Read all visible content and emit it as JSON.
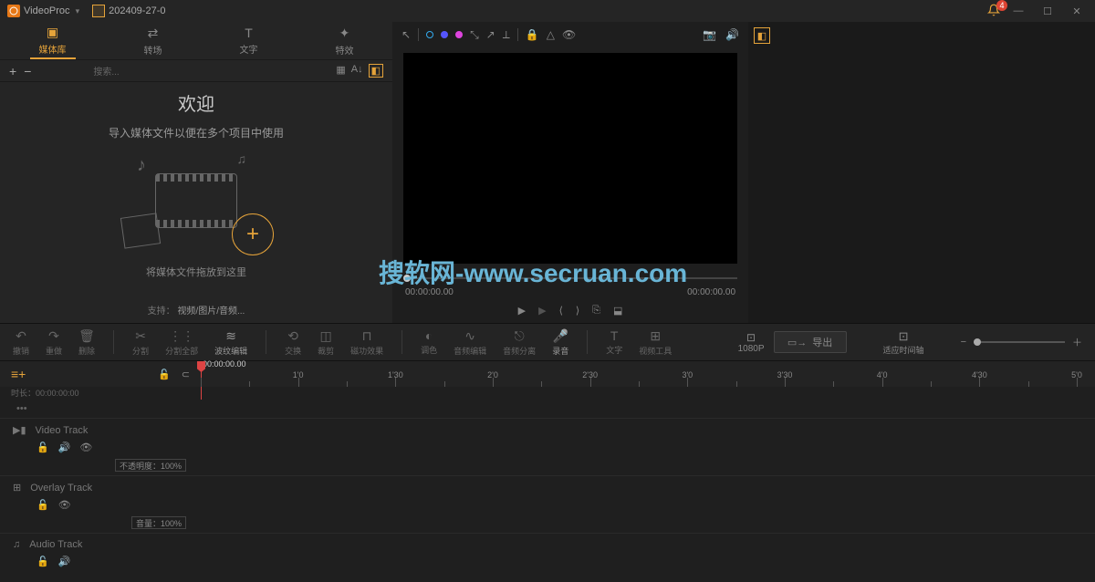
{
  "titlebar": {
    "app_name": "VideoProc",
    "project_name": "202409-27-0",
    "notif_count": "4"
  },
  "left_panel": {
    "tabs": [
      {
        "label": "媒体库"
      },
      {
        "label": "转场"
      },
      {
        "label": "文字"
      },
      {
        "label": "特效"
      }
    ],
    "search_placeholder": "搜索...",
    "welcome": {
      "title": "欢迎",
      "subtitle": "导入媒体文件以便在多个项目中使用",
      "drop_hint": "将媒体文件拖放到这里",
      "support_prefix": "支持：",
      "support_types": "视频/图片/音频..."
    }
  },
  "preview": {
    "time_current": "00:00:00.00",
    "time_total": "00:00:00.00"
  },
  "toolstrip": {
    "buttons": [
      {
        "label": "撤销"
      },
      {
        "label": "重做"
      },
      {
        "label": "删除"
      },
      {
        "label": "分割"
      },
      {
        "label": "分割全部"
      },
      {
        "label": "波纹编辑"
      },
      {
        "label": "交换"
      },
      {
        "label": "裁剪"
      },
      {
        "label": "磁功效果"
      },
      {
        "label": "调色"
      },
      {
        "label": "音频编辑"
      },
      {
        "label": "音频分离"
      },
      {
        "label": "录音"
      },
      {
        "label": "文字"
      },
      {
        "label": "视频工具"
      }
    ],
    "resolution": "1080P",
    "export_label": "导出",
    "fit_label": "适应时间轴"
  },
  "timeline": {
    "timecode": "00:00:00.00",
    "info_prefix": "时长：",
    "info_value": "00:00:00:00",
    "marks": [
      "1'0",
      "1'30",
      "2'0",
      "2'30",
      "3'0",
      "3'30",
      "4'0",
      "4'30",
      "5'0"
    ]
  },
  "tracks": {
    "video": {
      "name": "Video Track"
    },
    "overlay": {
      "name": "Overlay Track",
      "opacity_label": "不透明度：",
      "opacity_value": "100%"
    },
    "audio": {
      "name": "Audio Track",
      "volume_label": "音量：",
      "volume_value": "100%"
    }
  },
  "watermark": "搜软网-www.secruan.com"
}
